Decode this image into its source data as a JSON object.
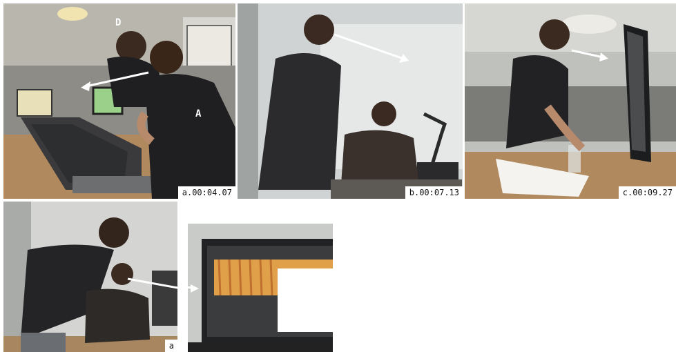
{
  "frames": [
    {
      "timestamp": "a.00:04.07",
      "person_labels": [
        "D",
        "A"
      ]
    },
    {
      "timestamp": "b.00:07.13"
    },
    {
      "timestamp": "c.00:09.27"
    },
    {
      "timestamp": "a"
    }
  ],
  "colors": {
    "arrow": "#ffffff",
    "label_bg": "#ffffff",
    "shirt": "#1f1f22",
    "wall": "#dcdcd8"
  }
}
